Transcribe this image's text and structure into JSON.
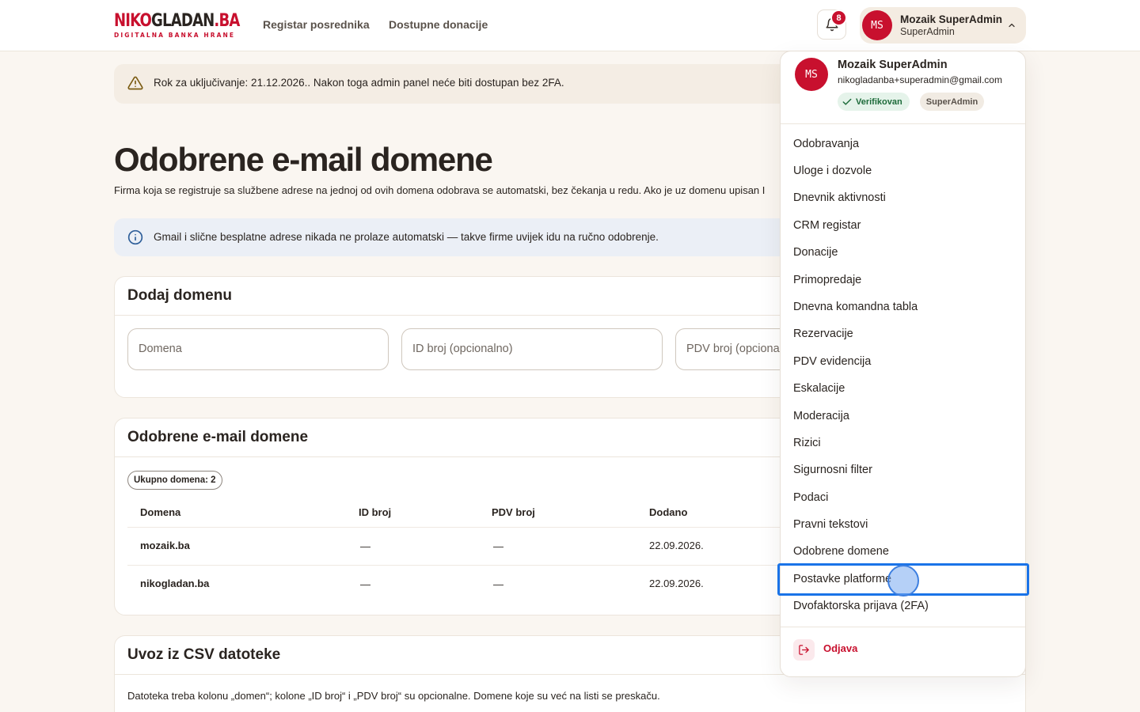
{
  "header": {
    "logo": {
      "part1": "NIKO",
      "part2": "GLADAN",
      "part3": ".BA",
      "tagline": "DIGITALNA BANKA HRANE"
    },
    "nav": [
      "Registar posrednika",
      "Dostupne donacije"
    ],
    "notification_count": "8",
    "user": {
      "initials": "MS",
      "name": "Mozaik SuperAdmin",
      "role": "SuperAdmin"
    }
  },
  "warning": {
    "text": "Rok za uključivanje: 21.12.2026.. Nakon toga admin panel neće biti dostupan bez 2FA."
  },
  "page": {
    "title": "Odobrene e-mail domene",
    "description": "Firma koja se registruje sa službene adrese na jednoj od ovih domena odobrava se automatski, bez čekanja u redu. Ako je uz domenu upisan I"
  },
  "info": {
    "text": "Gmail i slične besplatne adrese nikada ne prolaze automatski — takve firme uvijek idu na ručno odobrenje."
  },
  "add_card": {
    "title": "Dodaj domenu",
    "placeholders": {
      "domain": "Domena",
      "id": "ID broj (opcionalno)",
      "pdv": "PDV broj (opcional"
    }
  },
  "domains_card": {
    "title": "Odobrene e-mail domene",
    "count_label": "Ukupno domena: 2",
    "columns": [
      "Domena",
      "ID broj",
      "PDV broj",
      "Dodano"
    ],
    "rows": [
      {
        "domain": "mozaik.ba",
        "id": "—",
        "pdv": "—",
        "added": "22.09.2026."
      },
      {
        "domain": "nikogladan.ba",
        "id": "—",
        "pdv": "—",
        "added": "22.09.2026."
      }
    ]
  },
  "csv_card": {
    "title": "Uvoz iz CSV datoteke",
    "description": "Datoteka treba kolonu „domen“; kolone „ID broj“ i „PDV broj“ su opcionalne. Domene koje su već na listi se preskaču."
  },
  "dropdown": {
    "initials": "MS",
    "name": "Mozaik SuperAdmin",
    "email": "nikogladanba+superadmin@gmail.com",
    "verified": "Verifikovan",
    "role": "SuperAdmin",
    "items": [
      "Odobravanja",
      "Uloge i dozvole",
      "Dnevnik aktivnosti",
      "CRM registar",
      "Donacije",
      "Primopredaje",
      "Dnevna komandna tabla",
      "Rezervacije",
      "PDV evidencija",
      "Eskalacije",
      "Moderacija",
      "Rizici",
      "Sigurnosni filter",
      "Podaci",
      "Pravni tekstovi",
      "Odobrene domene",
      "Postavke platforme",
      "Dvofaktorska prijava (2FA)"
    ],
    "logout": "Odjava"
  },
  "colors": {
    "brand": "#c8102e",
    "background": "#faf6f1",
    "focus": "#1a73e8",
    "verified": "#1d6b3a"
  },
  "icons": [
    "bell-icon",
    "chevron-up-icon",
    "warning-icon",
    "info-icon",
    "check-icon",
    "logout-icon"
  ]
}
